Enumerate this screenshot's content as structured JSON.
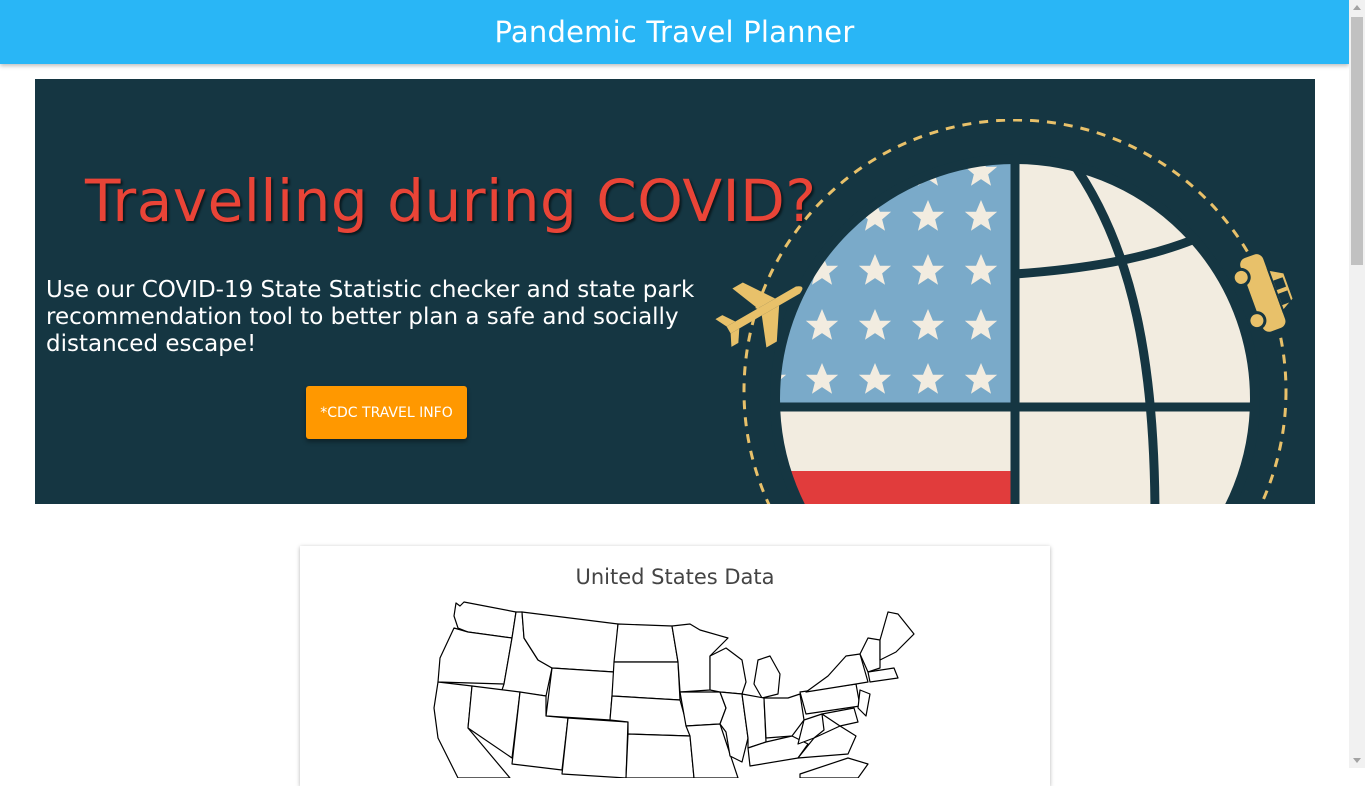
{
  "header": {
    "title": "Pandemic Travel Planner"
  },
  "hero": {
    "heading": "Travelling during COVID?",
    "description": "Use our COVID-19 State Statistic checker and state park recommendation tool to better plan a safe and socially distanced escape!",
    "button_label": "*CDC TRAVEL INFO"
  },
  "map_card": {
    "title": "United States Data"
  },
  "colors": {
    "header_bg": "#29b6f6",
    "hero_bg": "#153642",
    "heading_red": "#e94437",
    "button_orange": "#ff9800",
    "flag_blue": "#7aaac9",
    "flag_red": "#e13c3c",
    "cream": "#f2ece0",
    "accent_gold": "#e8c16a"
  },
  "icons": [
    "airplane-icon",
    "car-icon",
    "star-icon",
    "globe-icon"
  ]
}
